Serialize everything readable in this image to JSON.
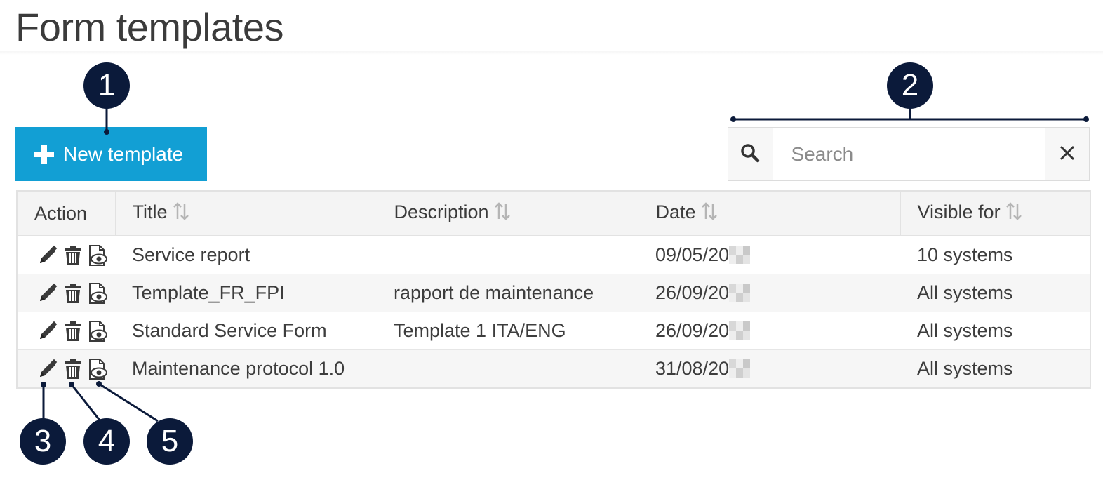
{
  "page": {
    "title": "Form templates"
  },
  "toolbar": {
    "new_template_label": "New template"
  },
  "search": {
    "placeholder": "Search"
  },
  "table": {
    "columns": [
      "Action",
      "Title",
      "Description",
      "Date",
      "Visible for"
    ],
    "rows": [
      {
        "title": "Service report",
        "description": "",
        "date": "09/05/20",
        "visible_for": "10 systems"
      },
      {
        "title": "Template_FR_FPI",
        "description": "rapport de maintenance",
        "date": "26/09/20",
        "visible_for": "All systems"
      },
      {
        "title": "Standard Service Form",
        "description": "Template 1 ITA/ENG",
        "date": "26/09/20",
        "visible_for": "All systems"
      },
      {
        "title": "Maintenance protocol 1.0",
        "description": "",
        "date": "31/08/20",
        "visible_for": "All systems"
      }
    ]
  },
  "callouts": [
    "1",
    "2",
    "3",
    "4",
    "5"
  ],
  "colors": {
    "primary": "#129fd4",
    "callout": "#0b1a3a",
    "header_bg": "#f4f4f4",
    "border": "#e2e2e2"
  },
  "icons": [
    "plus-icon",
    "search-icon",
    "close-icon",
    "sort-icon",
    "pencil-icon",
    "trash-icon",
    "preview-icon"
  ]
}
